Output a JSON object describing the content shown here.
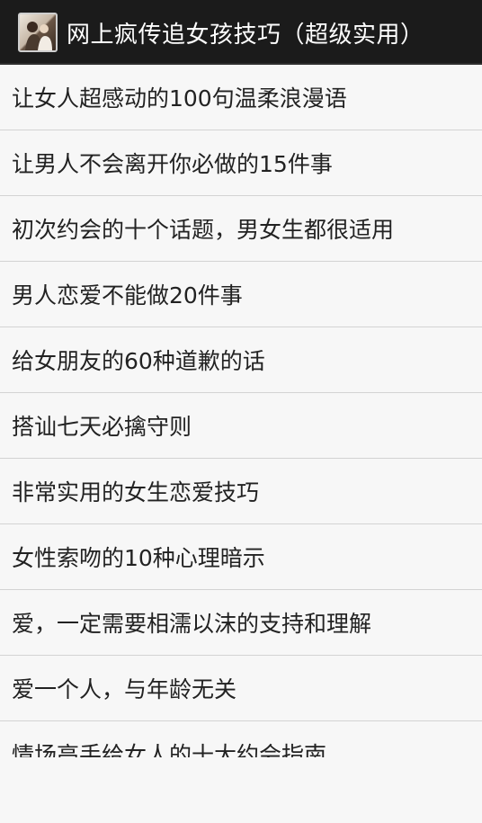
{
  "action_bar": {
    "icon": "app-avatar-icon",
    "title": "网上疯传追女孩技巧（超级实用）"
  },
  "list": {
    "items": [
      {
        "label": "让女人超感动的100句温柔浪漫语"
      },
      {
        "label": "让男人不会离开你必做的15件事"
      },
      {
        "label": "初次约会的十个话题，男女生都很适用"
      },
      {
        "label": "男人恋爱不能做20件事"
      },
      {
        "label": "给女朋友的60种道歉的话"
      },
      {
        "label": "搭讪七天必擒守则"
      },
      {
        "label": "非常实用的女生恋爱技巧"
      },
      {
        "label": "女性索吻的10种心理暗示"
      },
      {
        "label": "爱，一定需要相濡以沫的支持和理解"
      },
      {
        "label": "爱一个人，与年龄无关"
      },
      {
        "label": "情场高手给女人的十大约会指南"
      }
    ]
  }
}
